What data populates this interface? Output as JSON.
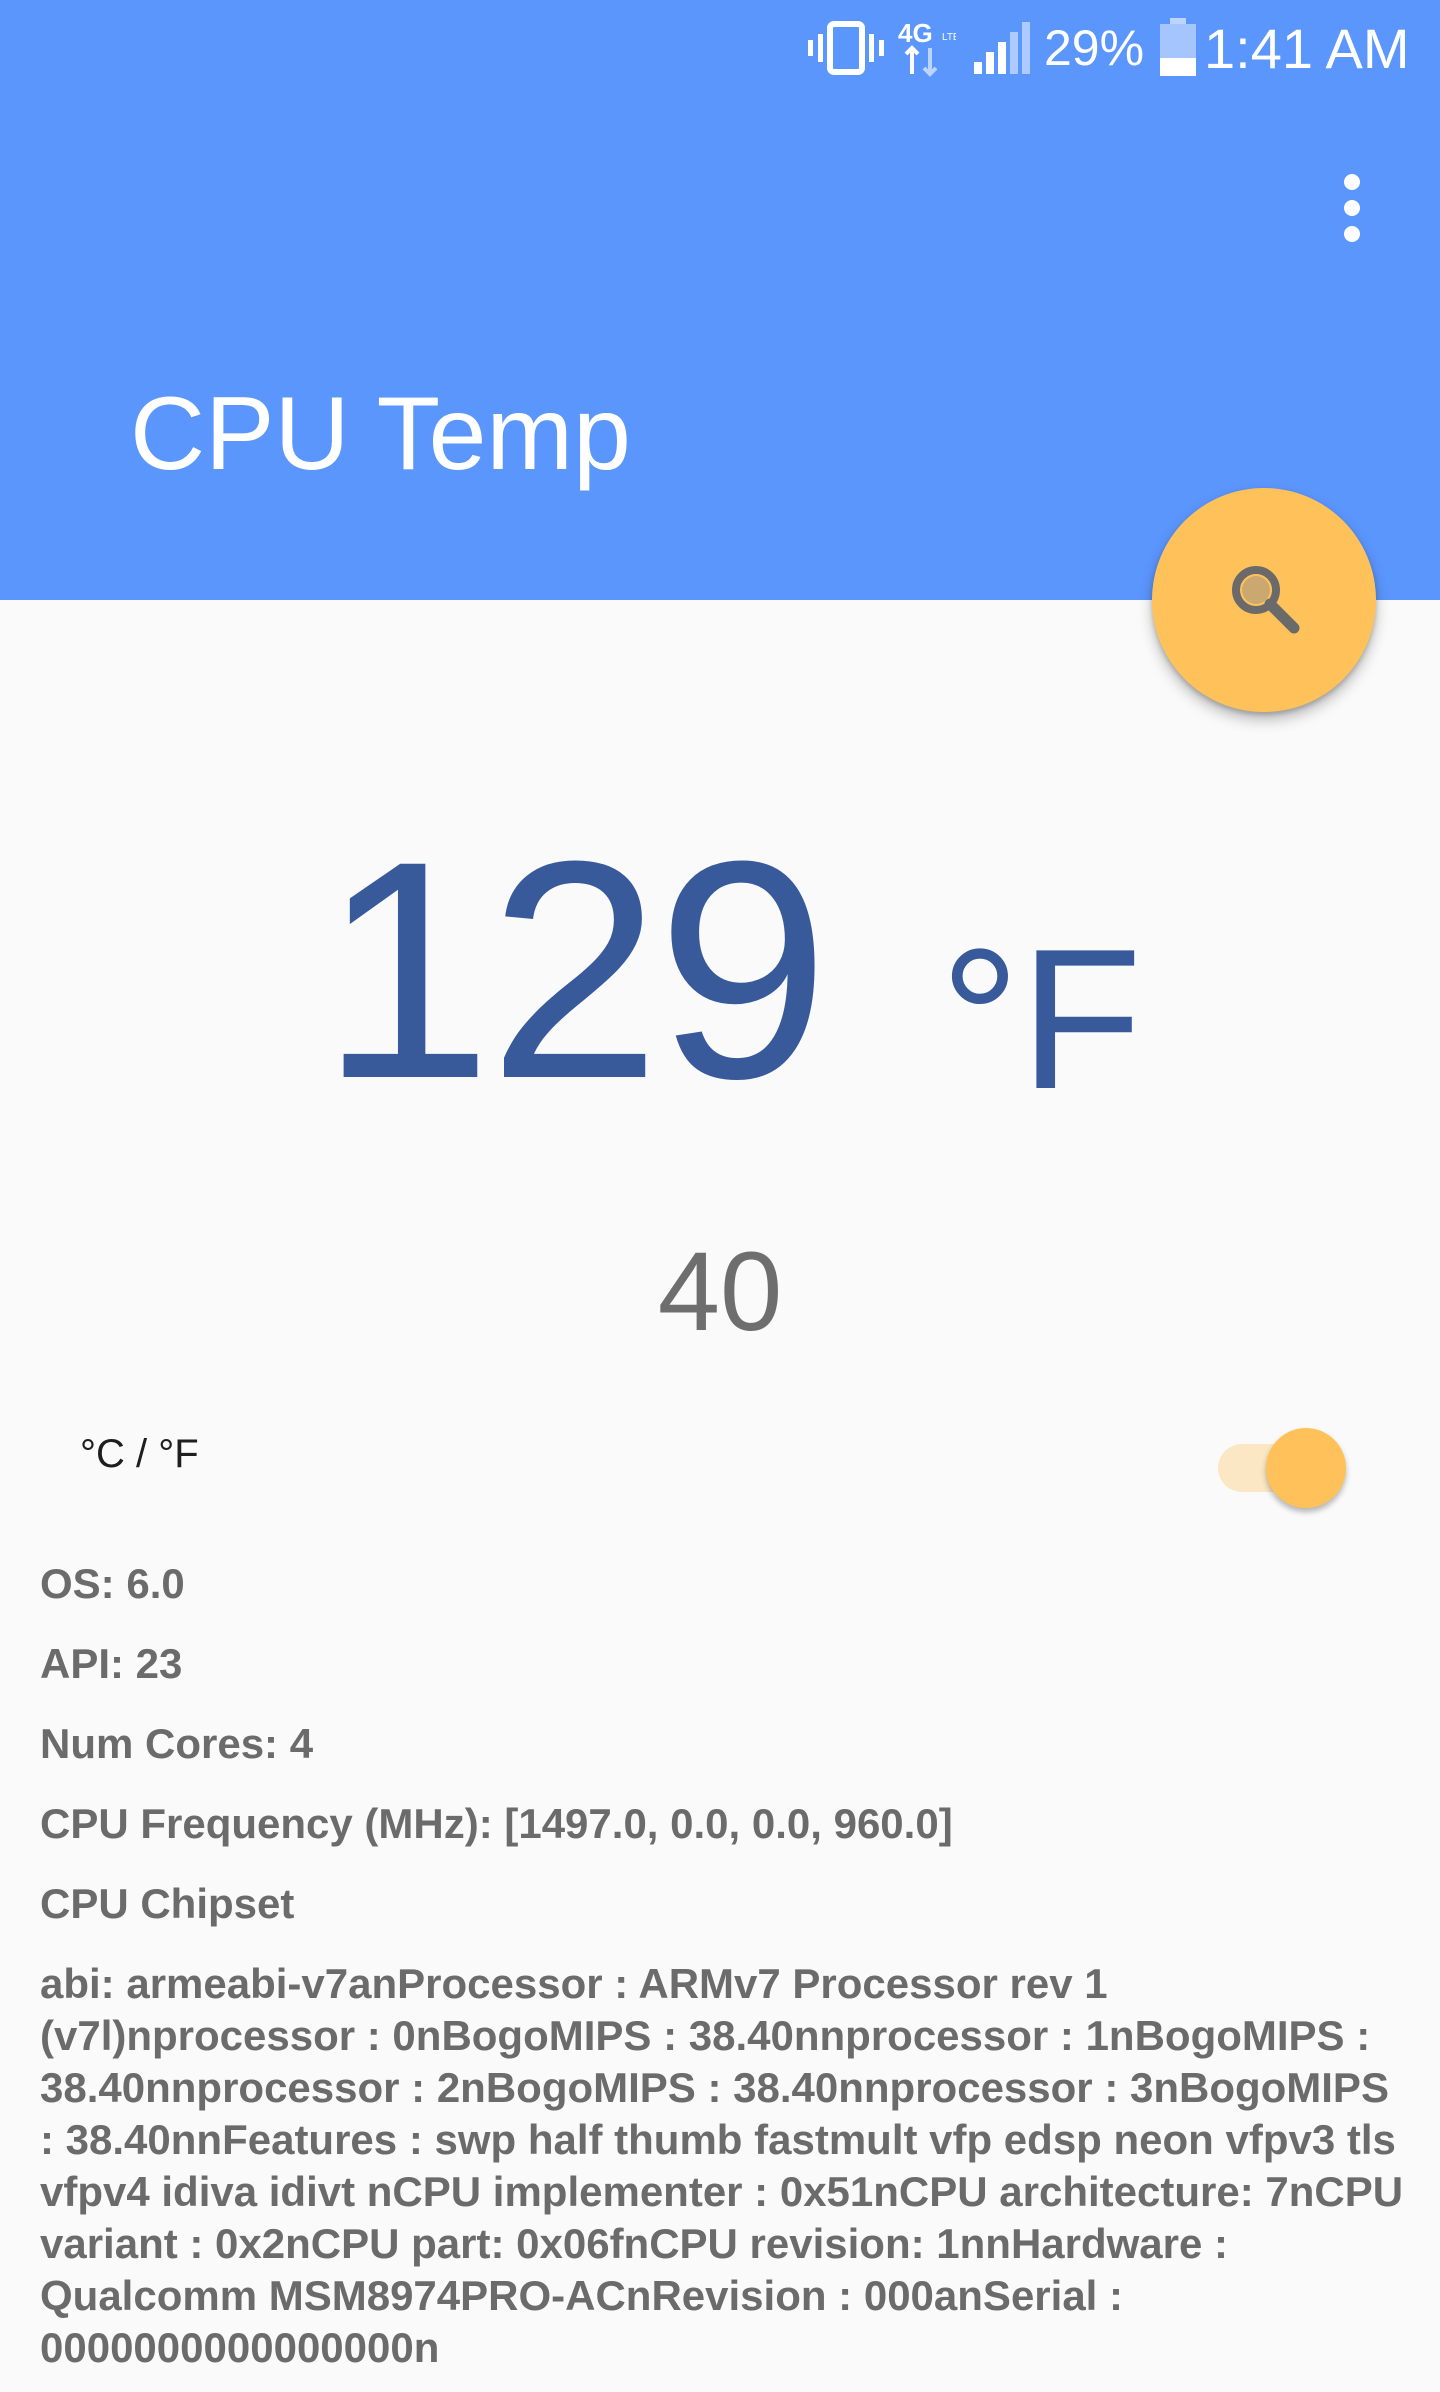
{
  "status_bar": {
    "battery_percent": "29%",
    "time": "1:41 AM",
    "icons": [
      "vibrate-icon",
      "network-4g-lte-icon",
      "signal-icon",
      "battery-icon"
    ]
  },
  "app_bar": {
    "title": "CPU Temp",
    "overflow_icon": "more-vert-icon",
    "color": "#5b96fd"
  },
  "fab": {
    "icon": "search-icon",
    "color": "#ffc25a"
  },
  "temperature": {
    "primary_value": "129",
    "primary_unit": "°F",
    "secondary_value": "40",
    "color": "#385a9b"
  },
  "unit_toggle": {
    "label": "°C / °F",
    "on": true
  },
  "info": {
    "os": "OS: 6.0",
    "api": "API: 23",
    "num_cores": "Num Cores: 4",
    "cpu_frequency": "CPU Frequency (MHz): [1497.0, 0.0, 0.0, 960.0]",
    "cpu_chipset": "CPU Chipset",
    "chipset_details": "abi: armeabi-v7anProcessor  : ARMv7 Processor rev 1 (v7l)nprocessor : 0nBogoMIPS  : 38.40nnprocessor  : 1nBogoMIPS  : 38.40nnprocessor  : 2nBogoMIPS  : 38.40nnprocessor  : 3nBogoMIPS  : 38.40nnFeatures  : swp half thumb fastmult vfp edsp neon vfpv3 tls vfpv4 idiva idivt nCPU implementer : 0x51nCPU architecture: 7nCPU variant : 0x2nCPU part: 0x06fnCPU revision: 1nnHardware  : Qualcomm MSM8974PRO-ACnRevision : 000anSerial  : 0000000000000000n"
  }
}
